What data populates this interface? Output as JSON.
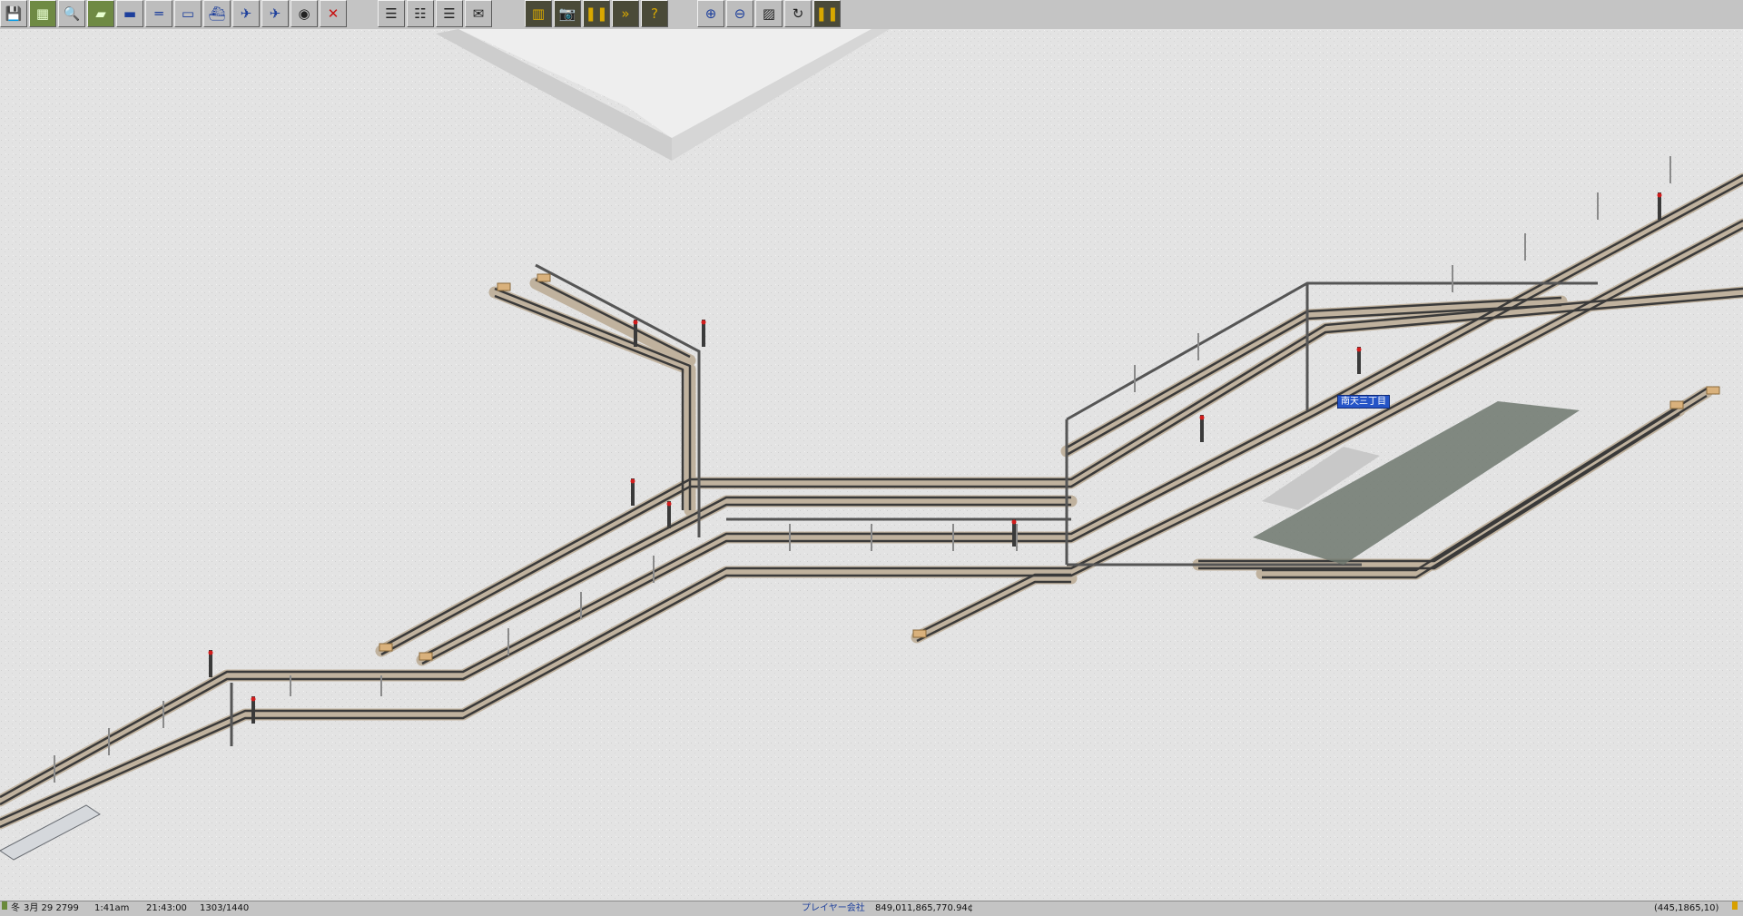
{
  "toolbar": {
    "groups": [
      {
        "name": "file",
        "buttons": [
          {
            "icon": "save-icon",
            "glyph": "💾"
          },
          {
            "icon": "map-overview-icon",
            "glyph": "▦"
          },
          {
            "icon": "magnifier-icon",
            "glyph": "🔍"
          },
          {
            "icon": "terrain-icon",
            "glyph": "▰"
          },
          {
            "icon": "rail-tools-icon",
            "glyph": "▬"
          },
          {
            "icon": "road-tools-icon",
            "glyph": "═"
          },
          {
            "icon": "monorail-tools-icon",
            "glyph": "▭"
          },
          {
            "icon": "ship-tools-icon",
            "glyph": "⛴"
          },
          {
            "icon": "aircraft-tools-icon",
            "glyph": "✈"
          },
          {
            "icon": "airport-tools-icon",
            "glyph": "✈"
          },
          {
            "icon": "special-build-icon",
            "glyph": "◉"
          },
          {
            "icon": "remove-icon",
            "glyph": "✕"
          }
        ]
      },
      {
        "name": "lists",
        "buttons": [
          {
            "icon": "line-list-icon",
            "glyph": "☰"
          },
          {
            "icon": "vehicle-list-icon",
            "glyph": "☷"
          },
          {
            "icon": "finance-list-icon",
            "glyph": "☰"
          },
          {
            "icon": "messages-icon",
            "glyph": "✉"
          }
        ]
      },
      {
        "name": "game",
        "buttons": [
          {
            "icon": "depot-icon",
            "glyph": "▥"
          },
          {
            "icon": "screenshot-icon",
            "glyph": "📷"
          },
          {
            "icon": "pause-icon",
            "glyph": "❚❚"
          },
          {
            "icon": "fast-forward-icon",
            "glyph": "»"
          },
          {
            "icon": "help-icon",
            "glyph": "?"
          }
        ]
      },
      {
        "name": "view",
        "buttons": [
          {
            "icon": "zoom-in-icon",
            "glyph": "⊕"
          },
          {
            "icon": "zoom-out-icon",
            "glyph": "⊖"
          },
          {
            "icon": "grid-icon",
            "glyph": "▨"
          },
          {
            "icon": "rotate-icon",
            "glyph": "↻"
          },
          {
            "icon": "pause-icon-2",
            "glyph": "❚❚"
          }
        ]
      }
    ]
  },
  "map": {
    "station_label": "南天三丁目",
    "colors": {
      "ground": "#e3e3e3",
      "rail_ballast": "#b8a894",
      "rail_line": "#2e2e2e",
      "catenary": "#7e7e7e",
      "platform": "#7f8b7f",
      "signal_red": "#d21c1c",
      "bumper": "#d8b078"
    }
  },
  "statusbar": {
    "season": "冬",
    "date": "3月 29 2799",
    "time": "1:41am",
    "ticks": "21:43:00",
    "frame": "1303/1440",
    "player": "プレイヤー会社",
    "money": "849,011,865,770.94¢",
    "coords": "(445,1865,10)"
  }
}
